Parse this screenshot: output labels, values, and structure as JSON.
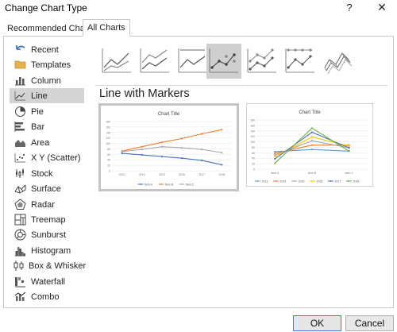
{
  "window": {
    "title": "Change Chart Type",
    "help": "?",
    "close": "✕"
  },
  "tabs": [
    {
      "label": "Recommended Charts"
    },
    {
      "label": "All Charts"
    }
  ],
  "sidebar": {
    "items": [
      {
        "label": "Recent",
        "icon": "undo-arrow-icon"
      },
      {
        "label": "Templates",
        "icon": "folder-icon"
      },
      {
        "label": "Column",
        "icon": "column-chart-icon"
      },
      {
        "label": "Line",
        "icon": "line-chart-icon"
      },
      {
        "label": "Pie",
        "icon": "pie-chart-icon"
      },
      {
        "label": "Bar",
        "icon": "bar-chart-icon"
      },
      {
        "label": "Area",
        "icon": "area-chart-icon"
      },
      {
        "label": "X Y (Scatter)",
        "icon": "scatter-chart-icon"
      },
      {
        "label": "Stock",
        "icon": "stock-chart-icon"
      },
      {
        "label": "Surface",
        "icon": "surface-chart-icon"
      },
      {
        "label": "Radar",
        "icon": "radar-chart-icon"
      },
      {
        "label": "Treemap",
        "icon": "treemap-chart-icon"
      },
      {
        "label": "Sunburst",
        "icon": "sunburst-chart-icon"
      },
      {
        "label": "Histogram",
        "icon": "histogram-chart-icon"
      },
      {
        "label": "Box & Whisker",
        "icon": "box-whisker-chart-icon"
      },
      {
        "label": "Waterfall",
        "icon": "waterfall-chart-icon"
      },
      {
        "label": "Combo",
        "icon": "combo-chart-icon"
      }
    ],
    "selected_label": "Line"
  },
  "main": {
    "subtypes": [
      {
        "icon": "line-subtype-icon"
      },
      {
        "icon": "stacked-line-subtype-icon"
      },
      {
        "icon": "100-stacked-line-subtype-icon"
      },
      {
        "icon": "line-with-markers-subtype-icon"
      },
      {
        "icon": "stacked-line-markers-subtype-icon"
      },
      {
        "icon": "100-stacked-line-markers-subtype-icon"
      },
      {
        "icon": "3d-line-subtype-icon"
      }
    ],
    "selected_subtype": "Line with Markers",
    "section_title": "Line with Markers"
  },
  "colors": {
    "series_blue": "#4472c4",
    "series_orange": "#ed7d31",
    "series_gray": "#a5a5a5",
    "series_yellow": "#ffc000",
    "series_lightblue": "#5b9bd5",
    "series_green": "#70ad47",
    "accent": "#3c7fd9"
  },
  "chart_data": [
    {
      "type": "line",
      "title": "Chart Title",
      "x": [
        "2013",
        "2014",
        "2015",
        "2016",
        "2017",
        "2018"
      ],
      "ylim": [
        0,
        180
      ],
      "yticks": [
        "0",
        "20",
        "40",
        "60",
        "80",
        "100",
        "120",
        "140",
        "160",
        "180"
      ],
      "series": [
        {
          "name": "Item A",
          "values": [
            64,
            58,
            52,
            46,
            38,
            22
          ]
        },
        {
          "name": "Item B",
          "values": [
            72,
            88,
            104,
            118,
            135,
            150
          ]
        },
        {
          "name": "Item C",
          "values": [
            70,
            78,
            88,
            84,
            78,
            66
          ]
        }
      ]
    },
    {
      "type": "line",
      "title": "Chart Title",
      "x": [
        "Item A",
        "Item B",
        "Item C"
      ],
      "ylim": [
        0,
        180
      ],
      "yticks": [
        "0",
        "20",
        "40",
        "60",
        "80",
        "100",
        "120",
        "140",
        "160",
        "180"
      ],
      "series": [
        {
          "name": "2013",
          "values": [
            64,
            72,
            66
          ]
        },
        {
          "name": "2014",
          "values": [
            58,
            88,
            88
          ]
        },
        {
          "name": "2015",
          "values": [
            52,
            104,
            78
          ]
        },
        {
          "name": "2016",
          "values": [
            46,
            118,
            84
          ]
        },
        {
          "name": "2017",
          "values": [
            38,
            135,
            78
          ]
        },
        {
          "name": "2018",
          "values": [
            22,
            150,
            66
          ]
        }
      ]
    }
  ],
  "footer": {
    "ok": "OK",
    "cancel": "Cancel"
  }
}
